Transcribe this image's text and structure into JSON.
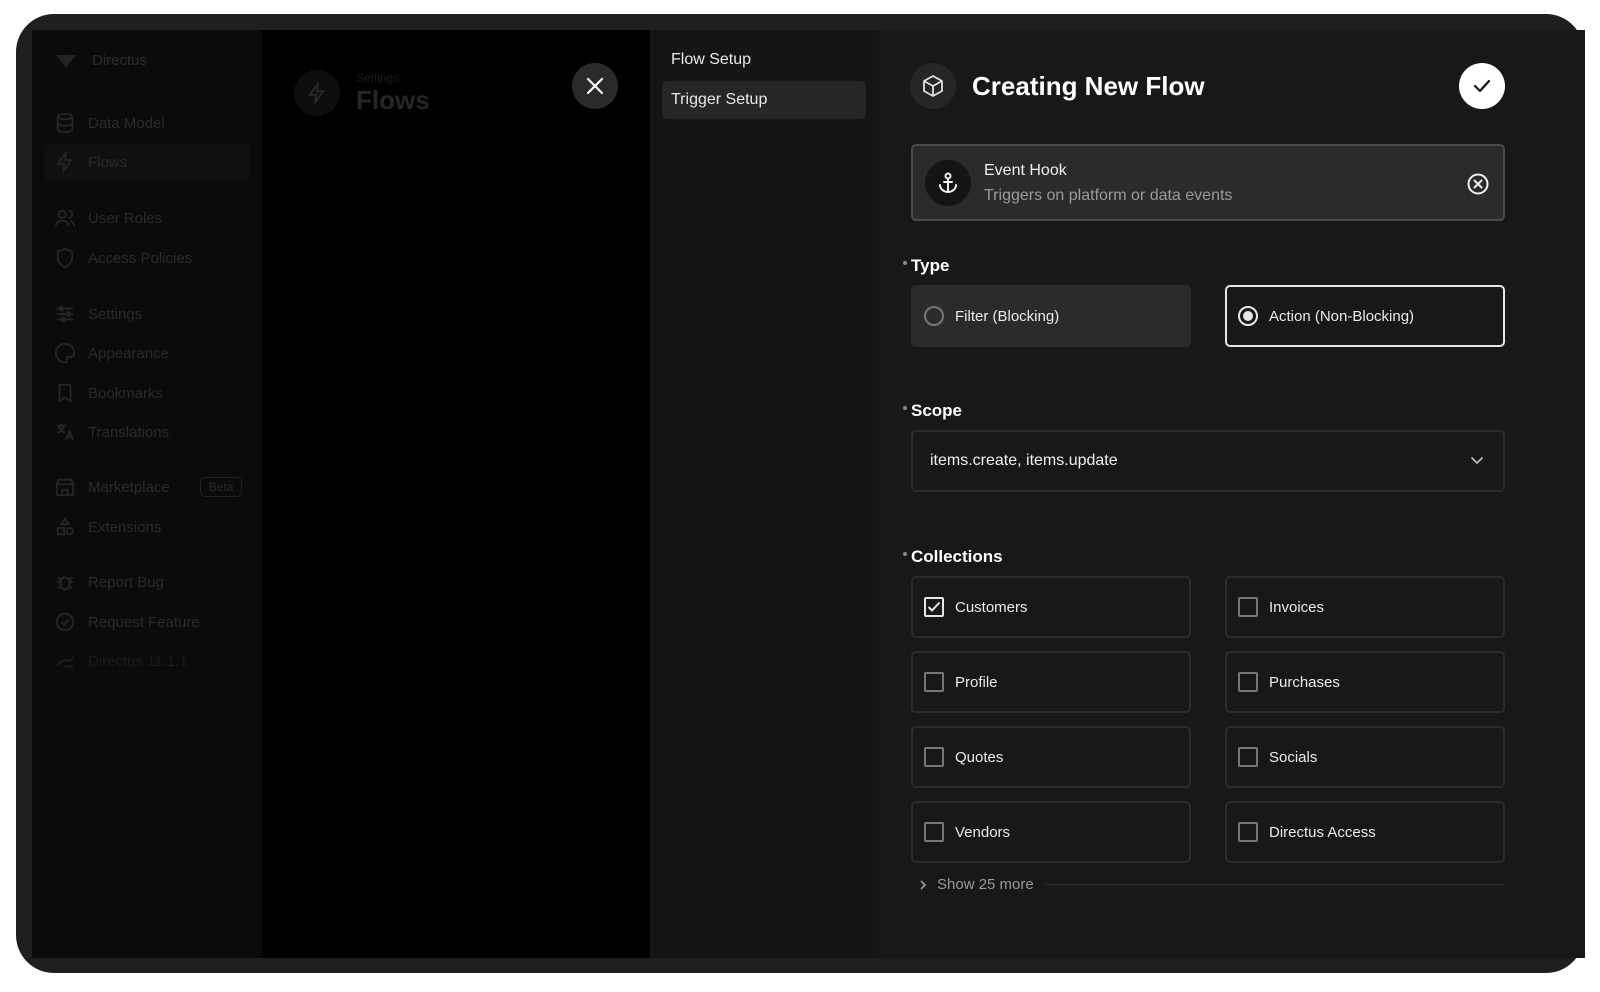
{
  "app": {
    "brand": "Directus",
    "sidebar": [
      {
        "label": "Data Model",
        "icon": "database-icon"
      },
      {
        "label": "Flows",
        "icon": "bolt-icon"
      },
      {
        "label": "User Roles",
        "icon": "users-icon"
      },
      {
        "label": "Access Policies",
        "icon": "shield-icon"
      },
      {
        "label": "Settings",
        "icon": "sliders-icon"
      },
      {
        "label": "Appearance",
        "icon": "palette-icon"
      },
      {
        "label": "Bookmarks",
        "icon": "bookmark-icon"
      },
      {
        "label": "Translations",
        "icon": "translate-icon"
      },
      {
        "label": "Marketplace",
        "icon": "store-icon",
        "badge": "Beta"
      },
      {
        "label": "Extensions",
        "icon": "extensions-icon"
      },
      {
        "label": "Report Bug",
        "icon": "bug-icon"
      },
      {
        "label": "Request Feature",
        "icon": "feature-icon"
      },
      {
        "label": "Directus 11.1.1",
        "icon": "rabbit-icon"
      }
    ],
    "header": {
      "breadcrumb": "Settings",
      "title": "Flows"
    }
  },
  "drawer": {
    "nav": [
      "Flow Setup",
      "Trigger Setup"
    ],
    "title": "Creating New Flow",
    "trigger": {
      "name": "Event Hook",
      "description": "Triggers on platform or data events"
    },
    "type": {
      "label": "Type",
      "options": [
        "Filter (Blocking)",
        "Action (Non-Blocking)"
      ],
      "selected": "Action (Non-Blocking)"
    },
    "scope": {
      "label": "Scope",
      "value": "items.create, items.update"
    },
    "collections": {
      "label": "Collections",
      "items": [
        {
          "label": "Customers",
          "checked": true
        },
        {
          "label": "Invoices",
          "checked": false
        },
        {
          "label": "Profile",
          "checked": false
        },
        {
          "label": "Purchases",
          "checked": false
        },
        {
          "label": "Quotes",
          "checked": false
        },
        {
          "label": "Socials",
          "checked": false
        },
        {
          "label": "Vendors",
          "checked": false
        },
        {
          "label": "Directus Access",
          "checked": false
        }
      ],
      "more": "Show 25 more"
    }
  }
}
